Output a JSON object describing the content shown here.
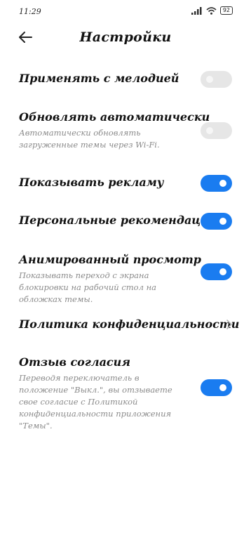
{
  "status_bar": {
    "time": "11:29",
    "battery": "92"
  },
  "header": {
    "title": "Настройки"
  },
  "settings": [
    {
      "title": "Применять с мелодией",
      "subtitle": "",
      "toggle_on": false
    },
    {
      "title": "Обновлять автоматически",
      "subtitle": "Автоматически обновлять загруженные темы через Wi-Fi.",
      "toggle_on": false
    },
    {
      "title": "Показывать рекламу",
      "subtitle": "",
      "toggle_on": true
    },
    {
      "title": "Персональные рекомендации",
      "subtitle": "",
      "toggle_on": true
    },
    {
      "title": "Анимированный просмотр",
      "subtitle": "Показывать переход с экрана блокировки на рабочий стол на обложках темы.",
      "toggle_on": true
    },
    {
      "title": "Политика конфиденциальности",
      "subtitle": "",
      "link": true
    },
    {
      "title": "Отзыв согласия",
      "subtitle": "Переводя переключатель в положение \"Выкл.\", вы отзываете свое согласие с Политикой конфиденциальности приложения \"Темы\".",
      "toggle_on": true
    }
  ],
  "colors": {
    "accent": "#1a7cf0",
    "toggle_off": "#e6e6e6",
    "subtitle": "#8a8a8a"
  },
  "icons": [
    "back-arrow-icon",
    "chevron-right-icon",
    "signal-icon",
    "wifi-icon",
    "battery-icon"
  ]
}
